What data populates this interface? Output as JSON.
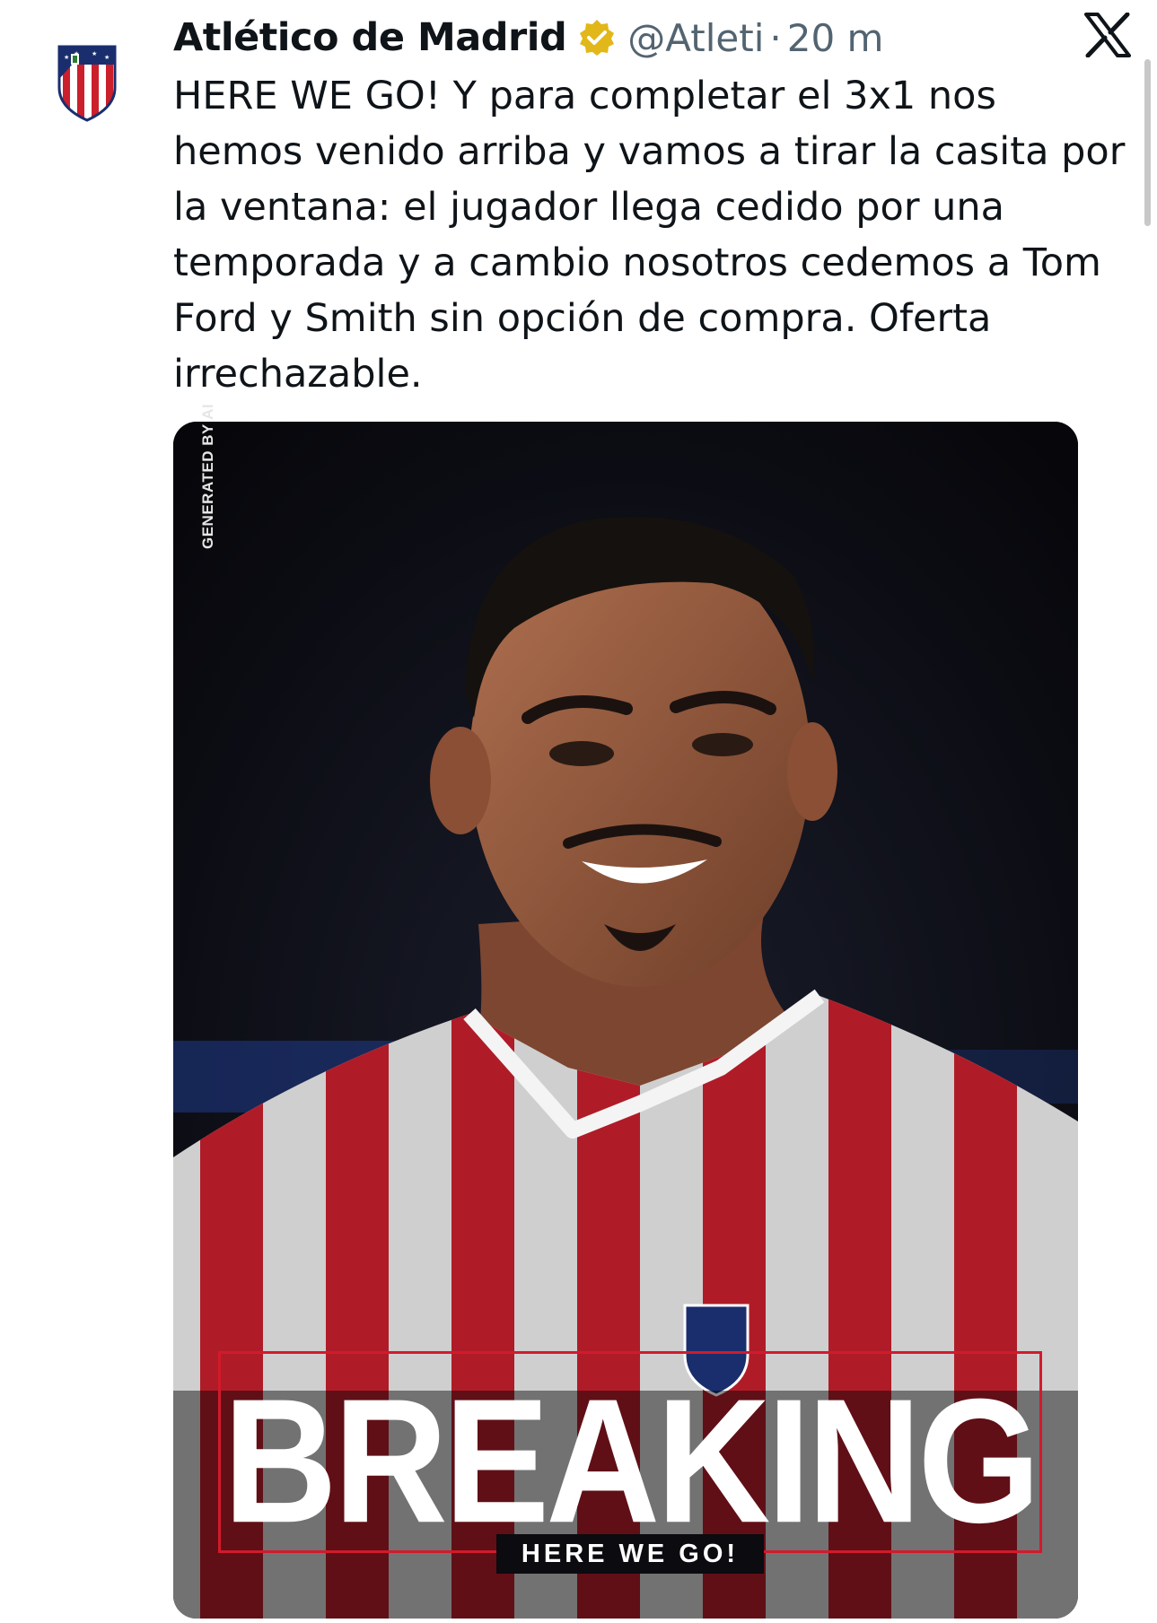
{
  "tweet": {
    "display_name": "Atlético de Madrid",
    "handle": "@Atleti",
    "separator": "·",
    "time": "20 m",
    "text": "HERE WE GO! Y para completar el 3x1 nos hemos venido arriba y vamos a tirar la casita por la ventana: el jugador llega cedido por una temporada y a cambio nosotros cedemos a Tom Ford y Smith sin opción de compra. Oferta irrechazable."
  },
  "media": {
    "ai_tag": "GENERATED BY AI",
    "headline": "BREAKING",
    "subline": "HERE WE GO!",
    "accent_color": "#d21a2c"
  },
  "icons": {
    "avatar": "atletico-crest-icon",
    "verified": "verified-badge-icon",
    "platform": "x-logo-icon"
  },
  "colors": {
    "text": "#0f1419",
    "secondary_text": "#536471",
    "verified_gold": "#e2b719"
  }
}
